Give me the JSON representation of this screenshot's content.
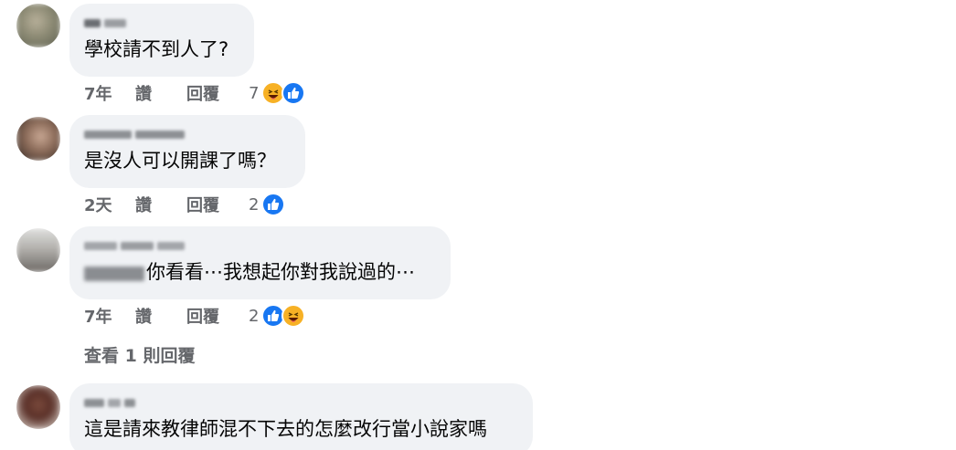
{
  "comments": [
    {
      "text": "學校請不到人了?",
      "time": "7年",
      "like_label": "讚",
      "reply_label": "回覆",
      "reaction_count": "7",
      "reactions": [
        "haha",
        "like"
      ]
    },
    {
      "text": "是沒人可以開課了嗎？",
      "time": "2天",
      "like_label": "讚",
      "reply_label": "回覆",
      "reaction_count": "2",
      "reactions": [
        "like"
      ]
    },
    {
      "text": "你看看⋯我想起你對我說過的⋯",
      "time": "7年",
      "like_label": "讚",
      "reply_label": "回覆",
      "reaction_count": "2",
      "reactions": [
        "like",
        "haha"
      ]
    },
    {
      "text": "這是請來教律師混不下去的怎麼改行當小說家嗎"
    }
  ],
  "view_replies_label": "查看 1 則回覆",
  "colors": {
    "bubble": "#f0f2f5",
    "meta_text": "#65676b",
    "like_blue": "#1877f2",
    "haha_yellow": "#f7b125"
  }
}
